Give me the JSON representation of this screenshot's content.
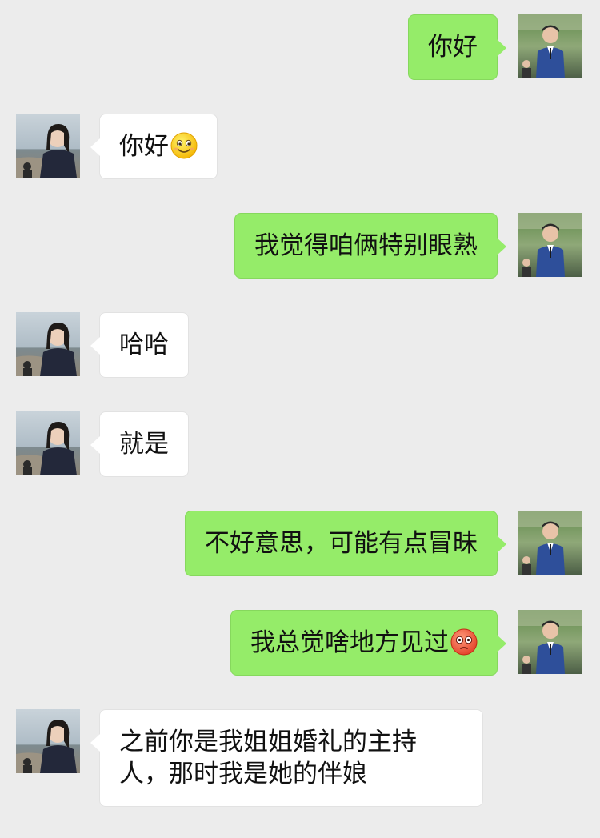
{
  "chat": {
    "messages": [
      {
        "sender": "me",
        "text": "你好",
        "emoji": null
      },
      {
        "sender": "other",
        "text": "你好",
        "emoji": "smiling-face-emoji"
      },
      {
        "sender": "me",
        "text": "我觉得咱俩特别眼熟",
        "emoji": null
      },
      {
        "sender": "other",
        "text": "哈哈",
        "emoji": null
      },
      {
        "sender": "other",
        "text": "就是",
        "emoji": null
      },
      {
        "sender": "me",
        "text": "不好意思，可能有点冒昧",
        "emoji": null
      },
      {
        "sender": "me",
        "text": "我总觉啥地方见过",
        "emoji": "flushed-face-emoji"
      },
      {
        "sender": "other",
        "text": "之前你是我姐姐婚礼的主持人，那时我是她的伴娘",
        "emoji": null
      }
    ]
  },
  "colors": {
    "background": "#ececec",
    "my_bubble": "#95ec69",
    "their_bubble": "#ffffff"
  }
}
